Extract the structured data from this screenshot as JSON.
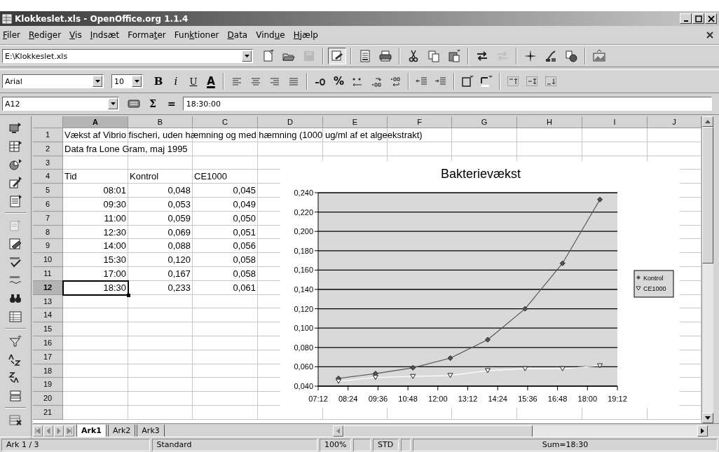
{
  "window": {
    "title": "Klokkeslet.xls - OpenOffice.org 1.1.4"
  },
  "menu": [
    {
      "key": "F",
      "after": "iler"
    },
    {
      "key": "R",
      "after": "ediger"
    },
    {
      "key": "V",
      "after": "is"
    },
    {
      "key": "I",
      "after": "ndsæt"
    },
    {
      "before": "Forma",
      "key": "t",
      "after": "er"
    },
    {
      "before": "Fun",
      "key": "k",
      "after": "tioner"
    },
    {
      "key": "D",
      "after": "ata"
    },
    {
      "before": "Vind",
      "key": "u",
      "after": "e"
    },
    {
      "key": "H",
      "after": "jælp"
    }
  ],
  "url_box": {
    "value": "E:\\Klokkeslet.xls"
  },
  "standard_toolbar": [
    {
      "disabled": false,
      "pressed": false
    },
    {
      "disabled": false,
      "pressed": false
    },
    {
      "disabled": true,
      "pressed": false
    },
    {
      "disabled": false,
      "pressed": true
    },
    {
      "disabled": false,
      "pressed": false
    },
    {
      "disabled": false,
      "pressed": false
    },
    {
      "disabled": false,
      "pressed": false
    },
    {
      "disabled": false,
      "pressed": false
    },
    {
      "disabled": false,
      "pressed": false
    },
    {
      "disabled": false,
      "pressed": false
    },
    {
      "disabled": true,
      "pressed": false
    },
    {
      "disabled": false,
      "pressed": false
    },
    {
      "disabled": false,
      "pressed": false
    },
    {
      "disabled": false,
      "pressed": false
    },
    {
      "disabled": false,
      "pressed": false
    }
  ],
  "formatting_toolbar": {
    "font": "Arial",
    "size": "10",
    "style_buttons": [
      {
        "label": "B"
      },
      {
        "label": "i"
      },
      {
        "label": "U"
      },
      {
        "label": "A"
      }
    ],
    "percent": "%"
  },
  "formula_bar": {
    "cell_ref": "A12",
    "sum_symbol": "Σ",
    "equals": "=",
    "value": "18:30:00"
  },
  "sheet": {
    "columns": [
      {
        "label": "A",
        "selected": true
      },
      {
        "label": "B",
        "selected": false
      },
      {
        "label": "C",
        "selected": false
      },
      {
        "label": "D",
        "selected": false
      },
      {
        "label": "E",
        "selected": false
      },
      {
        "label": "F",
        "selected": false
      },
      {
        "label": "G",
        "selected": false
      },
      {
        "label": "H",
        "selected": false
      },
      {
        "label": "I",
        "selected": false
      },
      {
        "label": "J",
        "selected": false
      }
    ],
    "rows": [
      {
        "number": "1",
        "selected": false,
        "cells": [
          {
            "kind": "text",
            "value": "Vækst af Vibrio fischeri, uden hæmning og med hæmning (1000 ug/ml af et algeekstrakt)"
          }
        ]
      },
      {
        "number": "2",
        "selected": false,
        "cells": [
          {
            "kind": "text",
            "value": "Data fra Lone Gram, maj 1995"
          }
        ]
      },
      {
        "number": "3",
        "selected": false,
        "cells": []
      },
      {
        "number": "4",
        "selected": false,
        "cells": [
          {
            "kind": "text",
            "value": "Tid"
          },
          {
            "kind": "text",
            "value": "Kontrol"
          },
          {
            "kind": "text",
            "value": "CE1000"
          }
        ]
      },
      {
        "number": "5",
        "selected": false,
        "cells": [
          {
            "kind": "number",
            "value": "08:01"
          },
          {
            "kind": "number",
            "value": "0,048"
          },
          {
            "kind": "number",
            "value": "0,045"
          }
        ]
      },
      {
        "number": "6",
        "selected": false,
        "cells": [
          {
            "kind": "number",
            "value": "09:30"
          },
          {
            "kind": "number",
            "value": "0,053"
          },
          {
            "kind": "number",
            "value": "0,049"
          }
        ]
      },
      {
        "number": "7",
        "selected": false,
        "cells": [
          {
            "kind": "number",
            "value": "11:00"
          },
          {
            "kind": "number",
            "value": "0,059"
          },
          {
            "kind": "number",
            "value": "0,050"
          }
        ]
      },
      {
        "number": "8",
        "selected": false,
        "cells": [
          {
            "kind": "number",
            "value": "12:30"
          },
          {
            "kind": "number",
            "value": "0,069"
          },
          {
            "kind": "number",
            "value": "0,051"
          }
        ]
      },
      {
        "number": "9",
        "selected": false,
        "cells": [
          {
            "kind": "number",
            "value": "14:00"
          },
          {
            "kind": "number",
            "value": "0,088"
          },
          {
            "kind": "number",
            "value": "0,056"
          }
        ]
      },
      {
        "number": "10",
        "selected": false,
        "cells": [
          {
            "kind": "number",
            "value": "15:30"
          },
          {
            "kind": "number",
            "value": "0,120"
          },
          {
            "kind": "number",
            "value": "0,058"
          }
        ]
      },
      {
        "number": "11",
        "selected": false,
        "cells": [
          {
            "kind": "number",
            "value": "17:00"
          },
          {
            "kind": "number",
            "value": "0,167"
          },
          {
            "kind": "number",
            "value": "0,058"
          }
        ]
      },
      {
        "number": "12",
        "selected": true,
        "cells": [
          {
            "kind": "number",
            "value": "18:30"
          },
          {
            "kind": "number",
            "value": "0,233"
          },
          {
            "kind": "number",
            "value": "0,061"
          }
        ]
      },
      {
        "number": "13",
        "selected": false,
        "cells": []
      },
      {
        "number": "14",
        "selected": false,
        "cells": []
      },
      {
        "number": "15",
        "selected": false,
        "cells": []
      },
      {
        "number": "16",
        "selected": false,
        "cells": []
      },
      {
        "number": "17",
        "selected": false,
        "cells": []
      },
      {
        "number": "18",
        "selected": false,
        "cells": []
      },
      {
        "number": "19",
        "selected": false,
        "cells": []
      },
      {
        "number": "20",
        "selected": false,
        "cells": []
      },
      {
        "number": "21",
        "selected": false,
        "cells": []
      }
    ]
  },
  "chart": {
    "chart_data": {
      "type": "line",
      "title": "Bakterievækst",
      "x": [
        8.0167,
        9.5,
        11,
        12.5,
        14,
        15.5,
        17,
        18.5
      ],
      "series": [
        {
          "name": "Kontrol",
          "color": "#555555",
          "marker": "diamond",
          "values": [
            0.048,
            0.053,
            0.059,
            0.069,
            0.088,
            0.12,
            0.167,
            0.233
          ]
        },
        {
          "name": "CE1000",
          "color": "#ffffff",
          "marker": "triangle",
          "values": [
            0.045,
            0.049,
            0.05,
            0.051,
            0.056,
            0.058,
            0.058,
            0.061
          ]
        }
      ],
      "xlim": [
        7.2,
        19.2
      ],
      "ylim": [
        0.04,
        0.24
      ],
      "grid": true,
      "legend": true,
      "xticks": [
        {
          "value": 7.2,
          "label": "07:12"
        },
        {
          "value": 8.4,
          "label": "08:24"
        },
        {
          "value": 9.6,
          "label": "09:36"
        },
        {
          "value": 10.8,
          "label": "10:48"
        },
        {
          "value": 12,
          "label": "12:00"
        },
        {
          "value": 13.2,
          "label": "13:12"
        },
        {
          "value": 14.4,
          "label": "14:24"
        },
        {
          "value": 15.6,
          "label": "15:36"
        },
        {
          "value": 16.8,
          "label": "16:48"
        },
        {
          "value": 18,
          "label": "18:00"
        },
        {
          "value": 19.2,
          "label": "19:12"
        }
      ],
      "yticks": [
        {
          "value": 0.04,
          "label": "0,040"
        },
        {
          "value": 0.06,
          "label": "0,060"
        },
        {
          "value": 0.08,
          "label": "0,080"
        },
        {
          "value": 0.1,
          "label": "0,100"
        },
        {
          "value": 0.12,
          "label": "0,120"
        },
        {
          "value": 0.14,
          "label": "0,140"
        },
        {
          "value": 0.16,
          "label": "0,160"
        },
        {
          "value": 0.18,
          "label": "0,180"
        },
        {
          "value": 0.2,
          "label": "0,200"
        },
        {
          "value": 0.22,
          "label": "0,220"
        },
        {
          "value": 0.24,
          "label": "0,240"
        }
      ]
    }
  },
  "sheet_tabs": [
    {
      "label": "Ark1",
      "selected": true
    },
    {
      "label": "Ark2",
      "selected": false
    },
    {
      "label": "Ark3",
      "selected": false
    }
  ],
  "status_bar": {
    "fields": [
      {
        "kind": "text",
        "text": "Ark 1 / 3"
      },
      {
        "kind": "text",
        "text": "Standard"
      },
      {
        "kind": "text",
        "text": "100%"
      },
      {
        "kind": "blank"
      },
      {
        "kind": "text",
        "text": "STD"
      },
      {
        "kind": "blank"
      },
      {
        "kind": "text",
        "text": "Sum=18:30"
      }
    ]
  }
}
